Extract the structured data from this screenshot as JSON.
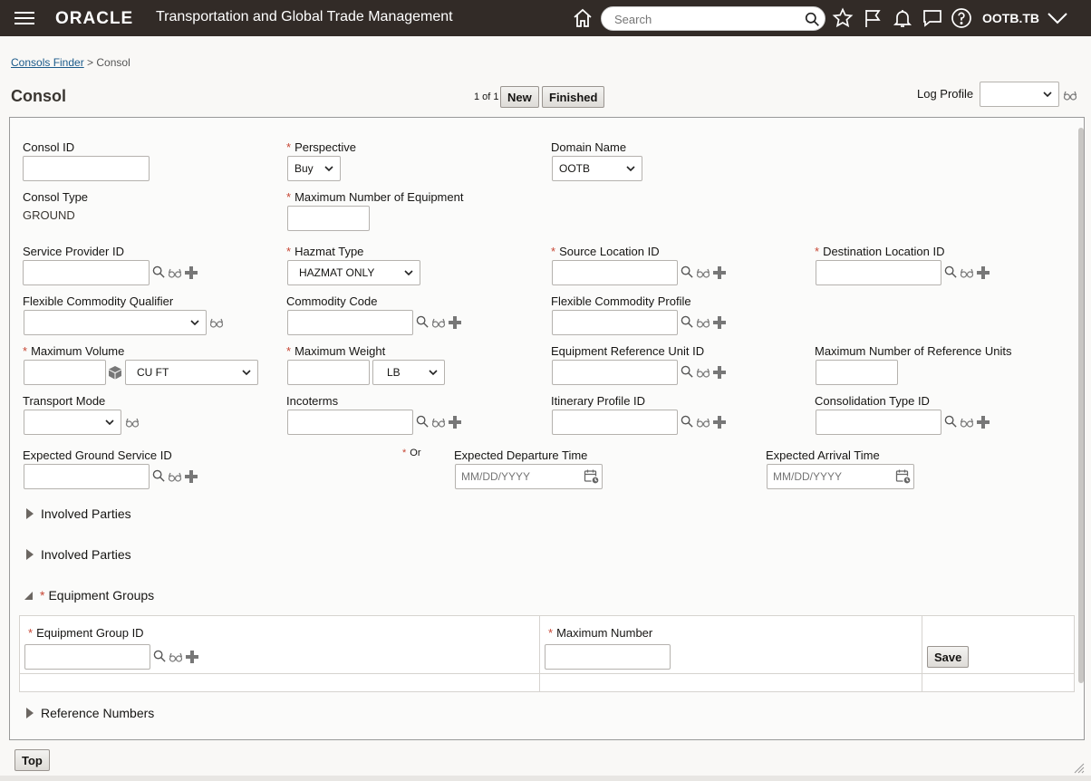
{
  "header": {
    "brand": "ORACLE",
    "product": "Transportation and Global Trade Management",
    "search_placeholder": "Search",
    "user": "OOTB.TB"
  },
  "breadcrumb": {
    "link": "Consols Finder",
    "separator": " > ",
    "current": "Consol"
  },
  "page": {
    "title": "Consol",
    "pager": "1 of 1",
    "new_label": "New",
    "finished_label": "Finished",
    "log_profile_label": "Log Profile"
  },
  "form": {
    "consol_id": "Consol ID",
    "perspective": "Perspective",
    "perspective_value": "Buy",
    "domain_name": "Domain Name",
    "domain_value": "OOTB",
    "consol_type": "Consol Type",
    "consol_type_value": "GROUND",
    "max_equipment": "Maximum Number of Equipment",
    "service_provider_id": "Service Provider ID",
    "hazmat_type": "Hazmat Type",
    "hazmat_value": "HAZMAT ONLY",
    "source_location_id": "Source Location ID",
    "destination_location_id": "Destination Location ID",
    "flexible_commodity_qualifier": "Flexible Commodity Qualifier",
    "commodity_code": "Commodity Code",
    "flexible_commodity_profile": "Flexible Commodity Profile",
    "max_volume": "Maximum Volume",
    "volume_unit": "CU FT",
    "max_weight": "Maximum Weight",
    "weight_unit": "LB",
    "equipment_reference_unit_id": "Equipment Reference Unit ID",
    "max_reference_units": "Maximum Number of Reference Units",
    "transport_mode": "Transport Mode",
    "incoterms": "Incoterms",
    "itinerary_profile_id": "Itinerary Profile ID",
    "consolidation_type_id": "Consolidation Type ID",
    "expected_ground_service_id": "Expected Ground Service ID",
    "or_label": "Or",
    "expected_departure_time": "Expected Departure Time",
    "expected_arrival_time": "Expected Arrival Time",
    "date_placeholder": "MM/DD/YYYY"
  },
  "sections": {
    "involved_parties_1": "Involved Parties",
    "involved_parties_2": "Involved Parties",
    "equipment_groups": "Equipment Groups",
    "reference_numbers": "Reference Numbers"
  },
  "equipment_table": {
    "equipment_group_id": "Equipment Group ID",
    "maximum_number": "Maximum Number",
    "save_label": "Save"
  },
  "footer": {
    "top_label": "Top"
  },
  "colors": {
    "header_bg": "#322b27",
    "required": "#c74634",
    "link": "#1a5a8a"
  }
}
